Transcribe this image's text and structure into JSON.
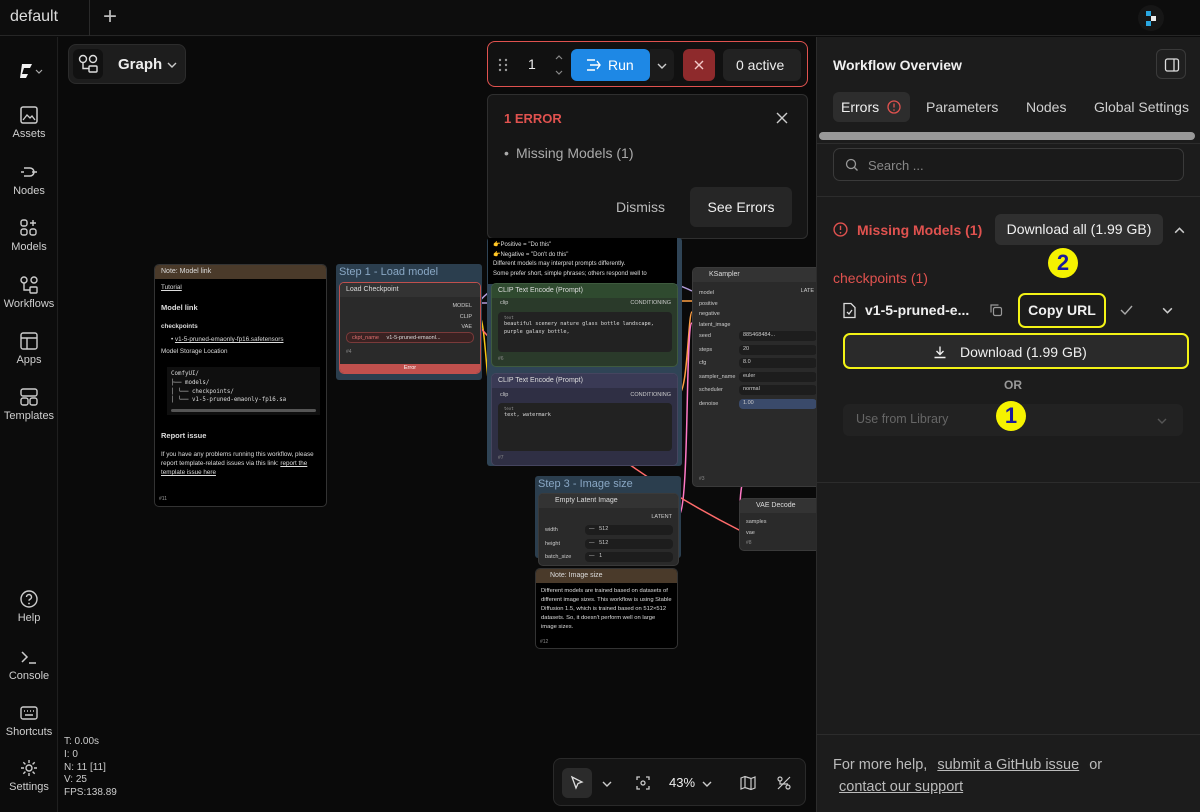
{
  "topbar": {
    "tab_label": "default",
    "add_tab_glyph": "+"
  },
  "sidebar": {
    "items": [
      {
        "label": "Assets",
        "icon": "image-icon"
      },
      {
        "label": "Nodes",
        "icon": "plug-icon"
      },
      {
        "label": "Models",
        "icon": "models-icon"
      },
      {
        "label": "Workflows",
        "icon": "workflow-icon"
      },
      {
        "label": "Apps",
        "icon": "apps-icon"
      },
      {
        "label": "Templates",
        "icon": "templates-icon"
      },
      {
        "label": "Help",
        "icon": "help-icon"
      },
      {
        "label": "Console",
        "icon": "terminal-icon"
      },
      {
        "label": "Shortcuts",
        "icon": "keyboard-icon"
      },
      {
        "label": "Settings",
        "icon": "gear-icon"
      }
    ]
  },
  "graph_button": {
    "label": "Graph"
  },
  "runbar": {
    "count": "1",
    "run_label": "Run",
    "active_label": "0 active"
  },
  "error_popup": {
    "title": "1 ERROR",
    "item": "Missing Models (1)",
    "dismiss": "Dismiss",
    "see_errors": "See Errors"
  },
  "nodes": {
    "note_model": {
      "header": "Note: Model link",
      "tutorial": "Tutorial",
      "heading": "Model link",
      "checkpoints": "checkpoints",
      "file_link": "v1-5-pruned-emaonly-fp16.safetensors",
      "storage": "Model Storage Location",
      "tree": [
        "ComfyUI/",
        "├── models/",
        "│   └── checkpoints/",
        "│       └── v1-5-pruned-emaonly-fp16.sa"
      ],
      "report_heading": "Report issue",
      "report_text": "If you have any problems running this workflow, please report template-related issues via this link:",
      "report_link": "report the template issue here",
      "id": "#11"
    },
    "group1": {
      "title": "Step 1 - Load model"
    },
    "load_checkpoint": {
      "header": "Load Checkpoint",
      "outputs": [
        "MODEL",
        "CLIP",
        "VAE"
      ],
      "widget_label": "ckpt_name",
      "widget_value": "v1-5-pruned-emaonl...",
      "id": "#4",
      "error": "Error"
    },
    "prompt_note": {
      "lines": [
        "👉Positive = \"Do this\"",
        "👉Negative = \"Don't do this\"",
        "Different models may interpret prompts differently.",
        "Some prefer short, simple phrases; others respond well to"
      ]
    },
    "clip_pos": {
      "header": "CLIP Text Encode (Prompt)",
      "input": "clip",
      "output": "CONDITIONING",
      "label": "text",
      "text": "beautiful scenery nature glass bottle landscape, purple galaxy bottle,",
      "id": "#6"
    },
    "clip_neg": {
      "header": "CLIP Text Encode (Prompt)",
      "input": "clip",
      "output": "CONDITIONING",
      "label": "text",
      "text": "text, watermark",
      "id": "#7"
    },
    "ksampler": {
      "header": "KSampler",
      "inputs": [
        "model",
        "positive",
        "negative",
        "latent_image"
      ],
      "output": "LATE",
      "widgets": [
        {
          "name": "seed",
          "value": "885468484..."
        },
        {
          "name": "steps",
          "value": "20"
        },
        {
          "name": "cfg",
          "value": "8.0"
        },
        {
          "name": "sampler_name",
          "value": "euler"
        },
        {
          "name": "scheduler",
          "value": "normal"
        },
        {
          "name": "denoise",
          "value": "1.00"
        }
      ],
      "id": "#3"
    },
    "group3": {
      "title": "Step 3 - Image size"
    },
    "latent": {
      "header": "Empty Latent Image",
      "output": "LATENT",
      "widgets": [
        {
          "name": "width",
          "value": "512"
        },
        {
          "name": "height",
          "value": "512"
        },
        {
          "name": "batch_size",
          "value": "1"
        }
      ]
    },
    "vae_decode": {
      "header": "VAE Decode",
      "inputs": [
        "samples",
        "vae"
      ],
      "id": "#8"
    },
    "note_size": {
      "header": "Note: Image size",
      "text": "Different models are trained based on datasets of different image sizes. This workflow is using Stable Diffusion 1.5, which is trained based on 512×512 datasets. So, it doesn't perform well on large image sizes.",
      "id": "#12"
    }
  },
  "stats": [
    "T: 0.00s",
    "I: 0",
    "N: 11 [11]",
    "V: 25",
    "FPS:138.89"
  ],
  "toolbox": {
    "zoom": "43%"
  },
  "panel": {
    "title": "Workflow Overview",
    "tabs": [
      "Errors",
      "Parameters",
      "Nodes",
      "Global Settings"
    ],
    "search_placeholder": "Search ...",
    "missing_title": "Missing Models (1)",
    "download_all": "Download all (1.99 GB)",
    "category": "checkpoints (1)",
    "model_name": "v1-5-pruned-e...",
    "copy_url": "Copy URL",
    "download": "Download (1.99 GB)",
    "or": "OR",
    "library_placeholder": "Use from Library",
    "help_prefix": "For more help,",
    "help_link1": "submit a GitHub issue",
    "help_or": "or",
    "help_link2": "contact our support"
  },
  "annotations": {
    "badge1": "1",
    "badge2": "2"
  },
  "colors": {
    "accent_blue": "#1e88e5",
    "error_red": "#e0524f",
    "highlight_yellow": "#f3f316"
  }
}
